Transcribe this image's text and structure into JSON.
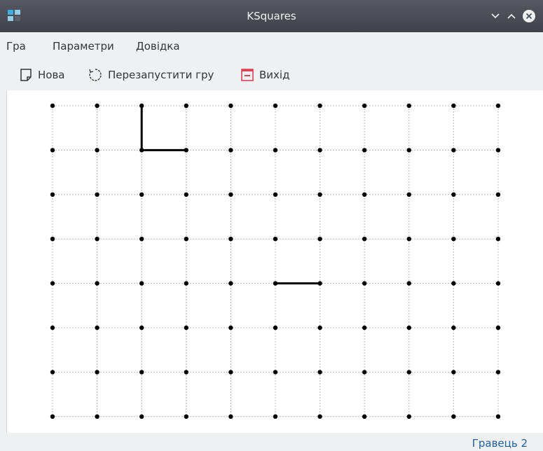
{
  "window": {
    "title": "KSquares"
  },
  "menu": [
    {
      "label": "Гра"
    },
    {
      "label": "Параметри"
    },
    {
      "label": "Довідка"
    }
  ],
  "toolbar": {
    "new_label": "Нова",
    "restart_label": "Перезапустити гру",
    "quit_label": "Вихід"
  },
  "board": {
    "columns": 11,
    "rows": 8,
    "drawn_lines": [
      {
        "from": [
          2,
          0
        ],
        "to": [
          2,
          1
        ]
      },
      {
        "from": [
          2,
          1
        ],
        "to": [
          3,
          1
        ]
      },
      {
        "from": [
          5,
          4
        ],
        "to": [
          6,
          4
        ]
      }
    ]
  },
  "status": {
    "text": "Гравець 2"
  },
  "colors": {
    "titlebar": "#475057",
    "status_text": "#1f5f9c",
    "quit_icon": "#da4453"
  }
}
